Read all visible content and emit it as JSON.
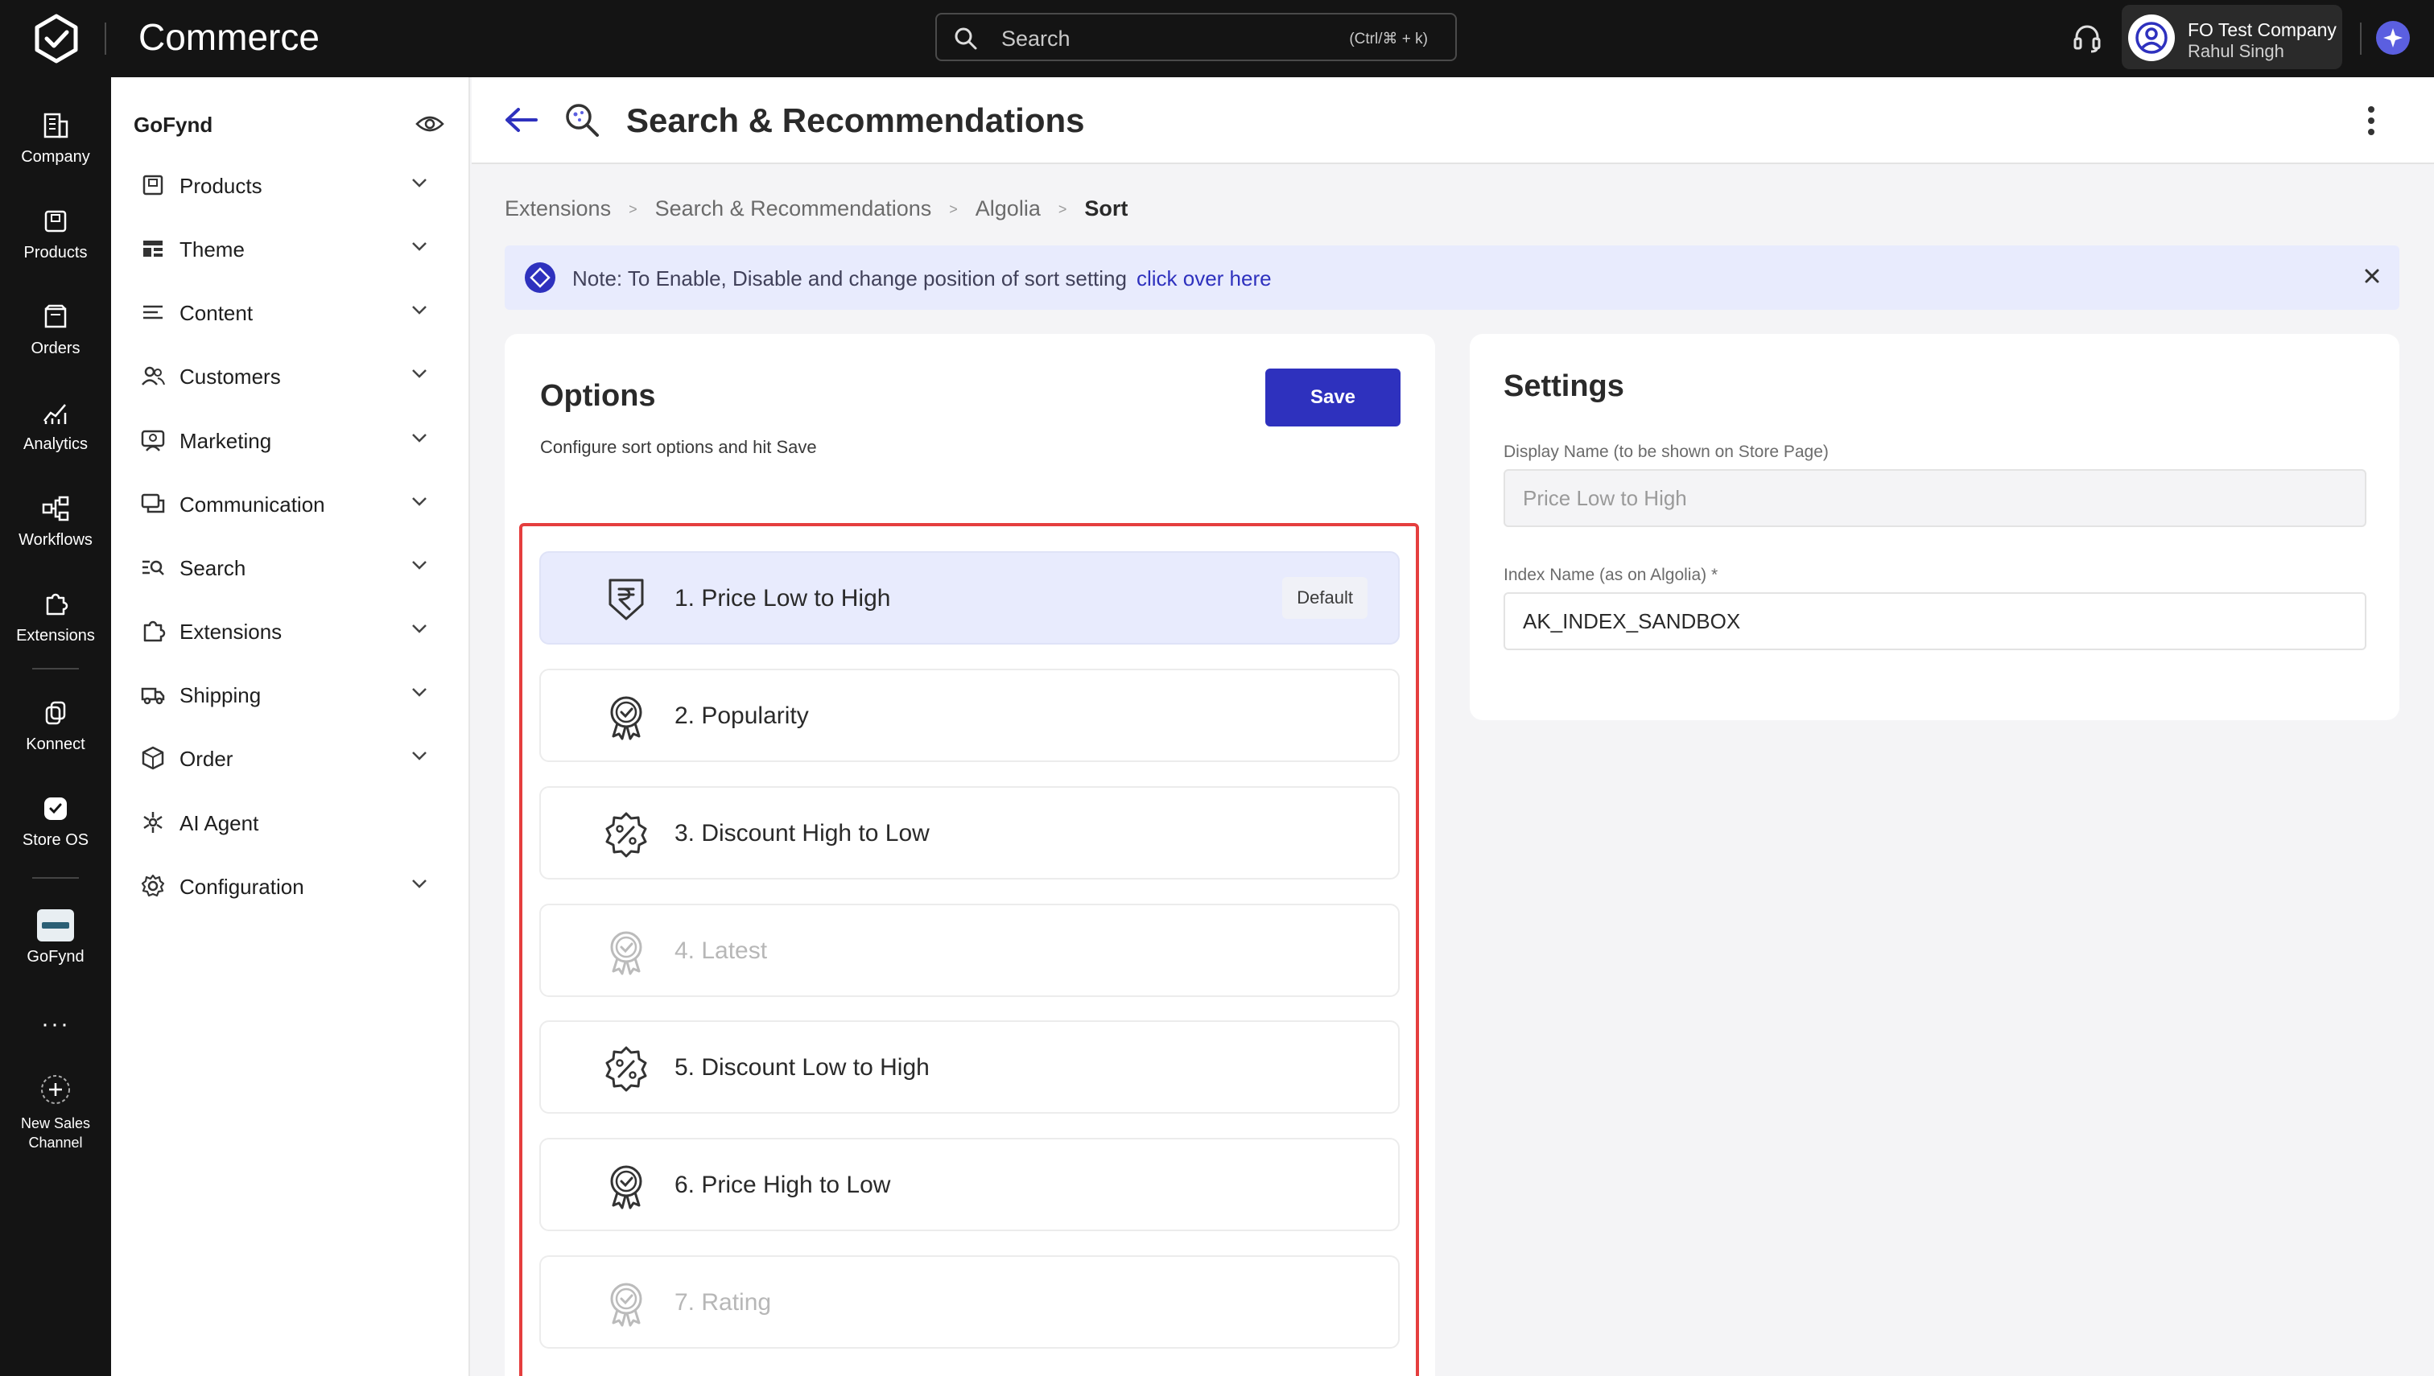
{
  "app": {
    "title": "Commerce"
  },
  "search": {
    "placeholder": "Search",
    "shortcut": "(Ctrl/⌘ + k)"
  },
  "user": {
    "company": "FO Test Company",
    "name": "Rahul Singh"
  },
  "rail": {
    "items": [
      {
        "label": "Company",
        "icon": "building-icon"
      },
      {
        "label": "Products",
        "icon": "box-icon"
      },
      {
        "label": "Orders",
        "icon": "orders-icon"
      },
      {
        "label": "Analytics",
        "icon": "analytics-icon"
      },
      {
        "label": "Workflows",
        "icon": "workflow-icon"
      },
      {
        "label": "Extensions",
        "icon": "puzzle-icon"
      },
      {
        "label": "Konnect",
        "icon": "konnect-icon"
      },
      {
        "label": "Store OS",
        "icon": "store-os-icon"
      },
      {
        "label": "GoFynd",
        "icon": "gofynd-thumbnail"
      }
    ],
    "more": "···",
    "new_channel": "New Sales Channel"
  },
  "sidenav": {
    "title": "GoFynd",
    "items": [
      {
        "label": "Products",
        "icon": "products-icon"
      },
      {
        "label": "Theme",
        "icon": "theme-icon"
      },
      {
        "label": "Content",
        "icon": "content-icon"
      },
      {
        "label": "Customers",
        "icon": "customers-icon"
      },
      {
        "label": "Marketing",
        "icon": "marketing-icon"
      },
      {
        "label": "Communication",
        "icon": "communication-icon"
      },
      {
        "label": "Search",
        "icon": "search-list-icon"
      },
      {
        "label": "Extensions",
        "icon": "extensions-icon"
      },
      {
        "label": "Shipping",
        "icon": "truck-icon"
      },
      {
        "label": "Order",
        "icon": "cube-icon"
      },
      {
        "label": "AI Agent",
        "icon": "ai-agent-icon"
      },
      {
        "label": "Configuration",
        "icon": "gear-icon"
      }
    ]
  },
  "header": {
    "title": "Search & Recommendations"
  },
  "breadcrumb": {
    "items": [
      "Extensions",
      "Search & Recommendations",
      "Algolia"
    ],
    "current": "Sort",
    "separator": ">"
  },
  "note": {
    "text": "Note: To Enable, Disable and change position of sort setting",
    "link": "click over here"
  },
  "options": {
    "title": "Options",
    "subtitle": "Configure sort options and hit Save",
    "save_label": "Save",
    "items": [
      {
        "label": "1. Price Low to High",
        "icon": "rupee-down-icon",
        "badge": "Default",
        "state": "active"
      },
      {
        "label": "2. Popularity",
        "icon": "award-icon",
        "state": "enabled"
      },
      {
        "label": "3. Discount High to Low",
        "icon": "discount-badge-icon",
        "state": "enabled"
      },
      {
        "label": "4. Latest",
        "icon": "award-icon",
        "state": "disabled"
      },
      {
        "label": "5. Discount Low to High",
        "icon": "discount-badge-icon",
        "state": "enabled"
      },
      {
        "label": "6. Price High to Low",
        "icon": "award-icon",
        "state": "enabled"
      },
      {
        "label": "7. Rating",
        "icon": "award-icon",
        "state": "disabled"
      }
    ]
  },
  "settings": {
    "title": "Settings",
    "display_name": {
      "label": "Display Name (to be shown on Store Page)",
      "value": "Price Low to High"
    },
    "index_name": {
      "label": "Index Name (as on Algolia) *",
      "value": "AK_INDEX_SANDBOX"
    }
  },
  "colors": {
    "accent": "#2e31be",
    "note_bg": "#e8ebfd",
    "highlight": "#e53e3e",
    "topbar": "#141414"
  }
}
